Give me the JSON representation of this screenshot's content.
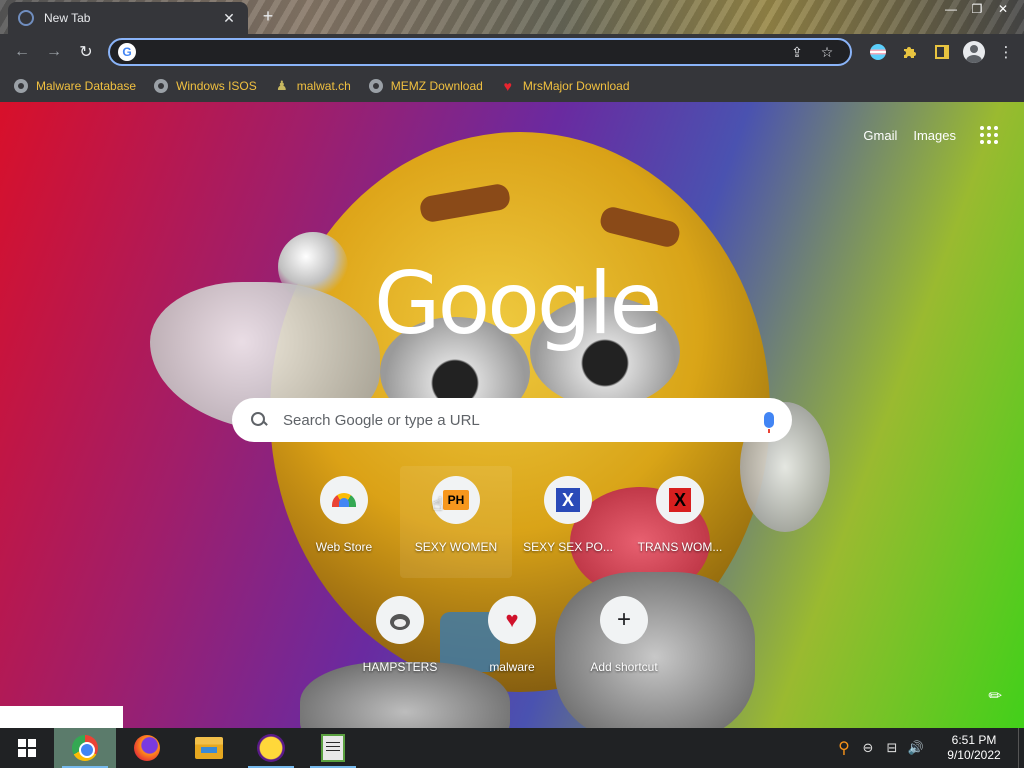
{
  "tab": {
    "title": "New Tab",
    "close": "✕",
    "new_tab": "+"
  },
  "window": {
    "minimize": "—",
    "restore": "❐",
    "close": "✕"
  },
  "toolbar": {
    "back": "←",
    "forward": "→",
    "reload": "↻",
    "omnibox_value": "",
    "omnibox_g": "G",
    "share": "⇪",
    "star": "☆",
    "menu": "⋮"
  },
  "bookmarks": [
    {
      "label": "Malware Database",
      "icon": "globe-icon"
    },
    {
      "label": "Windows ISOS",
      "icon": "globe-icon"
    },
    {
      "label": "malwat.ch",
      "icon": "person-icon"
    },
    {
      "label": "MEMZ Download",
      "icon": "globe-icon"
    },
    {
      "label": "MrsMajor Download",
      "icon": "heart-icon"
    }
  ],
  "ntp": {
    "gmail": "Gmail",
    "images": "Images",
    "logo": "Google",
    "search_placeholder": "Search Google or type a URL",
    "customize": "✎",
    "shortcuts_row1": [
      {
        "label": "Web Store",
        "icon": "webstore-icon"
      },
      {
        "label": "SEXY WOMEN",
        "icon": "ph-icon",
        "glyph": "PH"
      },
      {
        "label": "SEXY SEX PO...",
        "icon": "x-blue-icon",
        "glyph": "X"
      },
      {
        "label": "TRANS WOM...",
        "icon": "x-red-icon",
        "glyph": "X"
      }
    ],
    "shortcuts_row2": [
      {
        "label": "HAMPSTERS",
        "icon": "hamster-icon"
      },
      {
        "label": "malware",
        "icon": "heart-icon",
        "glyph": "♥"
      },
      {
        "label": "Add shortcut",
        "icon": "plus-icon",
        "glyph": "+"
      }
    ]
  },
  "taskbar": {
    "apps": [
      "chrome",
      "firefox",
      "file-explorer",
      "yahoo-messenger",
      "notepad-plus-plus"
    ],
    "tray": {
      "search": "⚲",
      "network": "⊟",
      "speaker": "🔊",
      "circle": "⊖"
    },
    "time": "6:51 PM",
    "date": "9/10/2022"
  },
  "colors": {
    "bookmark_text": "#f0c040",
    "omnibox_border": "#8ab4f8",
    "taskbar": "#202224"
  }
}
